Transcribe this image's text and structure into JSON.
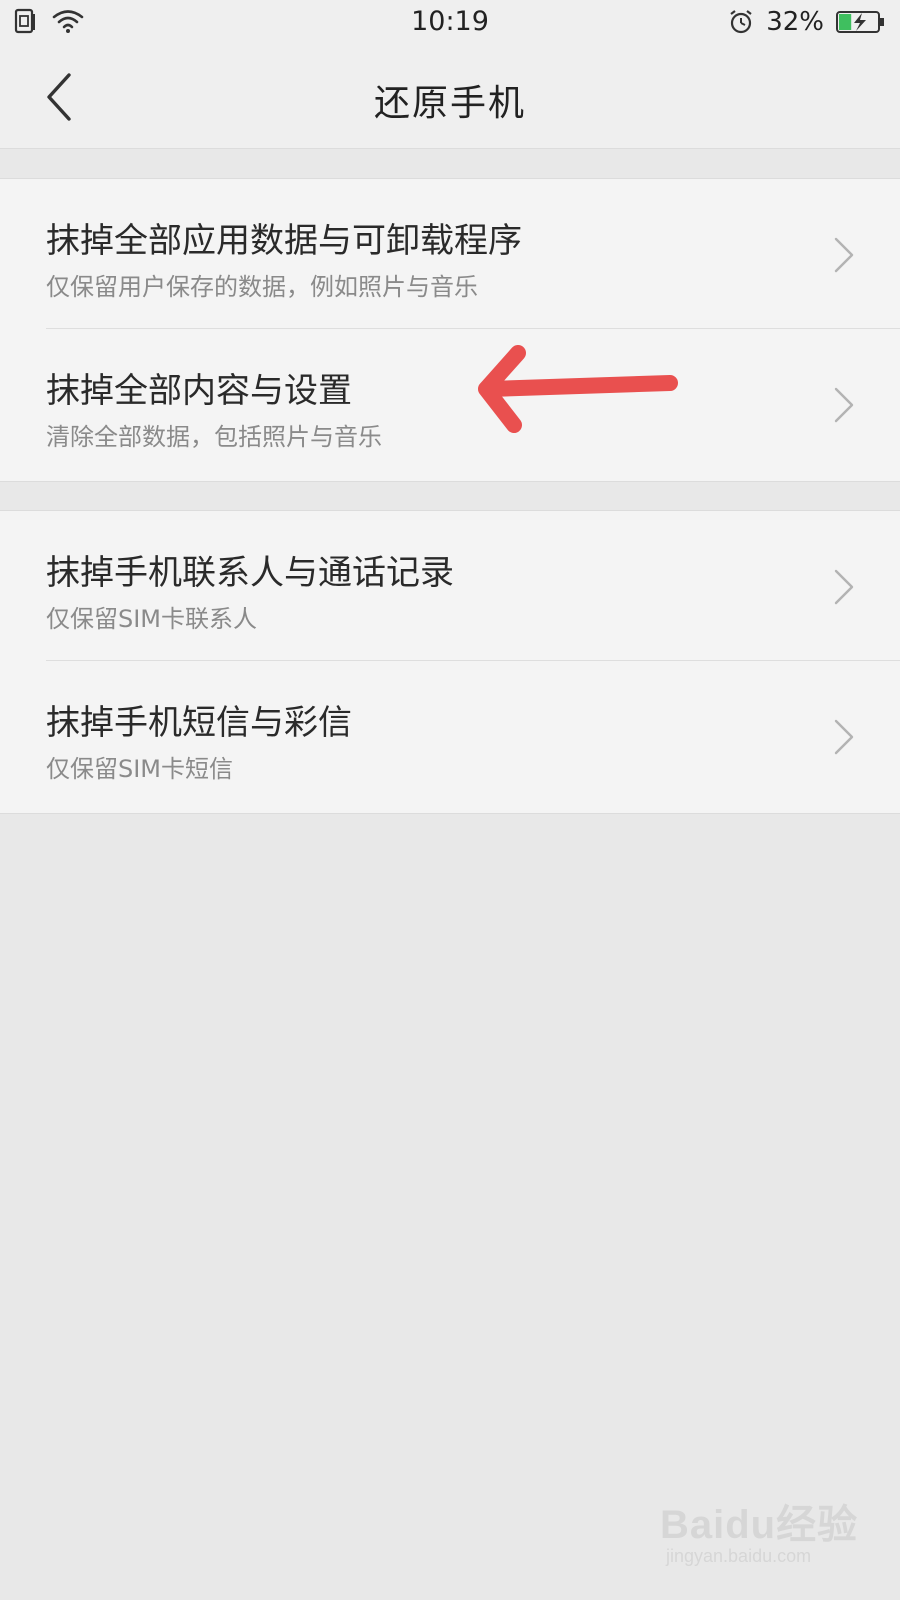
{
  "status_bar": {
    "time": "10:19",
    "battery_percent": "32%",
    "battery_level": 0.32,
    "battery_color": "#3fbf5f",
    "icons": [
      "sim-icon",
      "wifi-icon",
      "alarm-icon",
      "battery-charging-icon"
    ]
  },
  "nav": {
    "back_icon": "chevron-left-icon",
    "title": "还原手机"
  },
  "groups": [
    {
      "items": [
        {
          "title": "抹掉全部应用数据与可卸载程序",
          "subtitle": "仅保留用户保存的数据，例如照片与音乐"
        },
        {
          "title": "抹掉全部内容与设置",
          "subtitle": "清除全部数据，包括照片与音乐"
        }
      ]
    },
    {
      "items": [
        {
          "title": "抹掉手机联系人与通话记录",
          "subtitle": "仅保留SIM卡联系人"
        },
        {
          "title": "抹掉手机短信与彩信",
          "subtitle": "仅保留SIM卡短信"
        }
      ]
    }
  ],
  "annotation": {
    "arrow_color": "#e9504f"
  },
  "watermark": {
    "brand": "Baidu经验",
    "url": "jingyan.baidu.com"
  }
}
